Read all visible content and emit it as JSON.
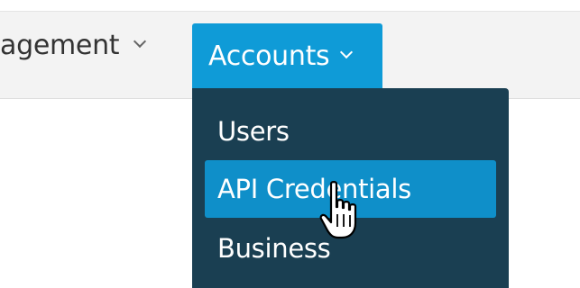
{
  "nav": {
    "management_label": "agement",
    "accounts_label": "Accounts"
  },
  "accounts_menu": {
    "items": [
      {
        "label": "Users",
        "active": false
      },
      {
        "label": "API Credentials",
        "active": true
      },
      {
        "label": "Business",
        "active": false
      }
    ]
  },
  "colors": {
    "accent": "#0f9bd7",
    "menu_bg": "#1a3f52",
    "menu_active": "#0f8fc9",
    "topbar_bg": "#f3f3f3"
  },
  "icons": {
    "chevron": "chevron-down-icon",
    "cursor": "hand-pointer-cursor-icon"
  }
}
